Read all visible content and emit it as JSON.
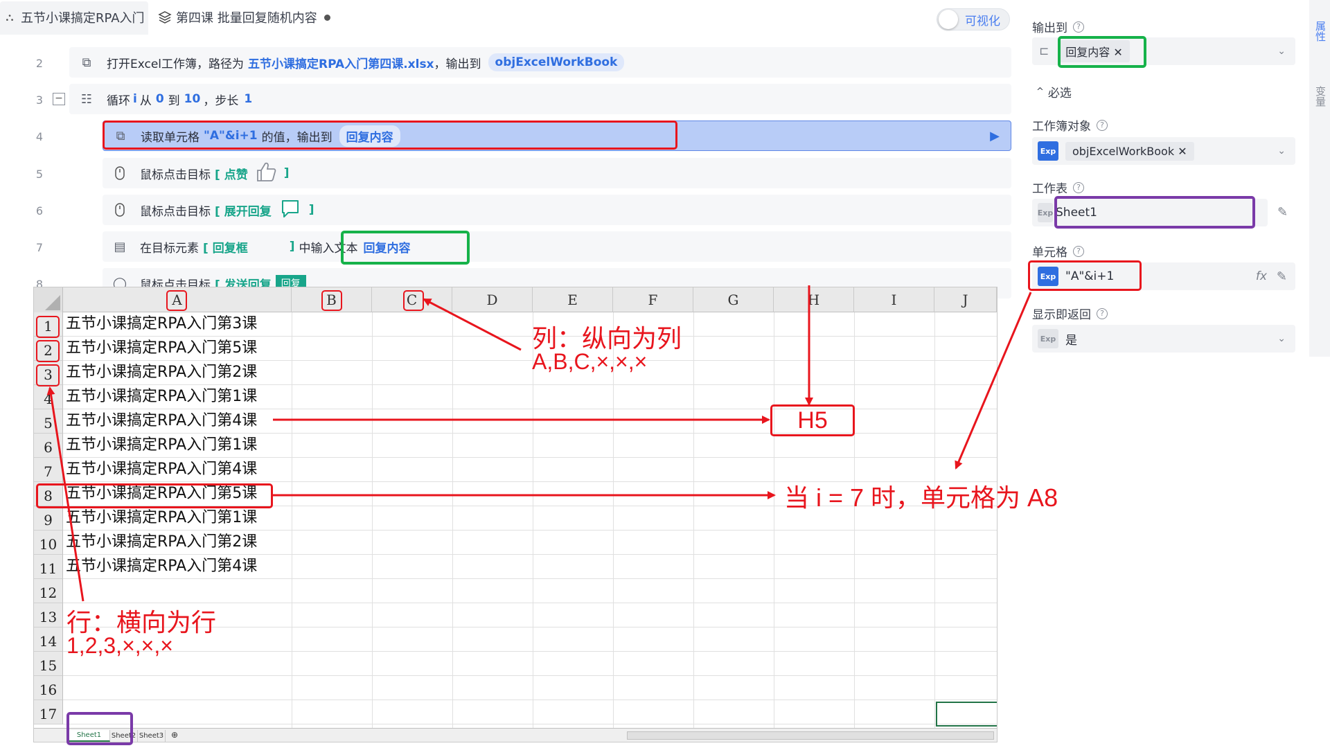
{
  "tabs": [
    {
      "label": "五节小课搞定RPA入门"
    },
    {
      "label": "第四课 批量回复随机内容"
    }
  ],
  "toggle": {
    "label": "可视化",
    "on": false
  },
  "flow": {
    "rows": [
      {
        "num": "2",
        "prefix": "打开Excel工作簿，路径为",
        "value": "五节小课搞定RPA入门第四课.xlsx",
        "mid": "，输出到",
        "pill": "objExcelWorkBook"
      },
      {
        "num": "3",
        "prefix": "循环",
        "var": "i",
        "from_label": "从",
        "from": "0",
        "to_label": "到",
        "to": "10",
        "step_label": "，步长",
        "step": "1"
      },
      {
        "num": "4",
        "prefix": "读取单元格",
        "expr": "\"A\"&i+1",
        "mid": "的值，输出到",
        "pill": "回复内容"
      },
      {
        "num": "5",
        "prefix": "鼠标点击目标",
        "target": "[ 点赞",
        "close": "]"
      },
      {
        "num": "6",
        "prefix": "鼠标点击目标",
        "target": "[ 展开回复",
        "close": "]"
      },
      {
        "num": "7",
        "prefix": "在目标元素",
        "target": "[ 回复框",
        "close": "]",
        "mid": "中输入文本",
        "pill": "回复内容"
      },
      {
        "num": "8",
        "prefix": "鼠标点击目标",
        "target": "[ 发送回复",
        "pill": "回复"
      }
    ]
  },
  "panel": {
    "output_label": "输出到",
    "output_chip": "回复内容",
    "section": "必选",
    "workbook_label": "工作簿对象",
    "workbook_value": "objExcelWorkBook",
    "sheet_label": "工作表",
    "sheet_value": "Sheet1",
    "cell_label": "单元格",
    "cell_value": "\"A\"&i+1",
    "fx": "fx",
    "return_label": "显示即返回",
    "return_value": "是",
    "exp_badge": "Exp",
    "vtab1": "属性",
    "vtab2": "变量"
  },
  "sheet": {
    "columns": [
      "A",
      "B",
      "C",
      "D",
      "E",
      "F",
      "G",
      "H",
      "I",
      "J"
    ],
    "rows": [
      "1",
      "2",
      "3",
      "4",
      "5",
      "6",
      "7",
      "8",
      "9",
      "10",
      "11",
      "12",
      "13",
      "14",
      "15",
      "16",
      "17"
    ],
    "cells_A": [
      "五节小课搞定RPA入门第3课",
      "五节小课搞定RPA入门第5课",
      "五节小课搞定RPA入门第2课",
      "五节小课搞定RPA入门第1课",
      "五节小课搞定RPA入门第4课",
      "五节小课搞定RPA入门第1课",
      "五节小课搞定RPA入门第4课",
      "五节小课搞定RPA入门第5课",
      "五节小课搞定RPA入门第1课",
      "五节小课搞定RPA入门第2课",
      "五节小课搞定RPA入门第4课"
    ],
    "sheet_tabs": [
      "Sheet1",
      "Sheet2",
      "Sheet3"
    ]
  },
  "annotations": {
    "col_title": "列：纵向为列",
    "col_list": "A,B,C,×,×,×",
    "row_title": "行：横向为行",
    "row_list": "1,2,3,×,×,×",
    "h5": "H5",
    "a8": "当 i = 7 时，单元格为 A8"
  },
  "colors": {
    "accent": "#2f6ee0",
    "target": "#18a58a",
    "annotation_red": "#e8151d",
    "annotation_green": "#16b24a",
    "annotation_purple": "#7a3aa8"
  }
}
